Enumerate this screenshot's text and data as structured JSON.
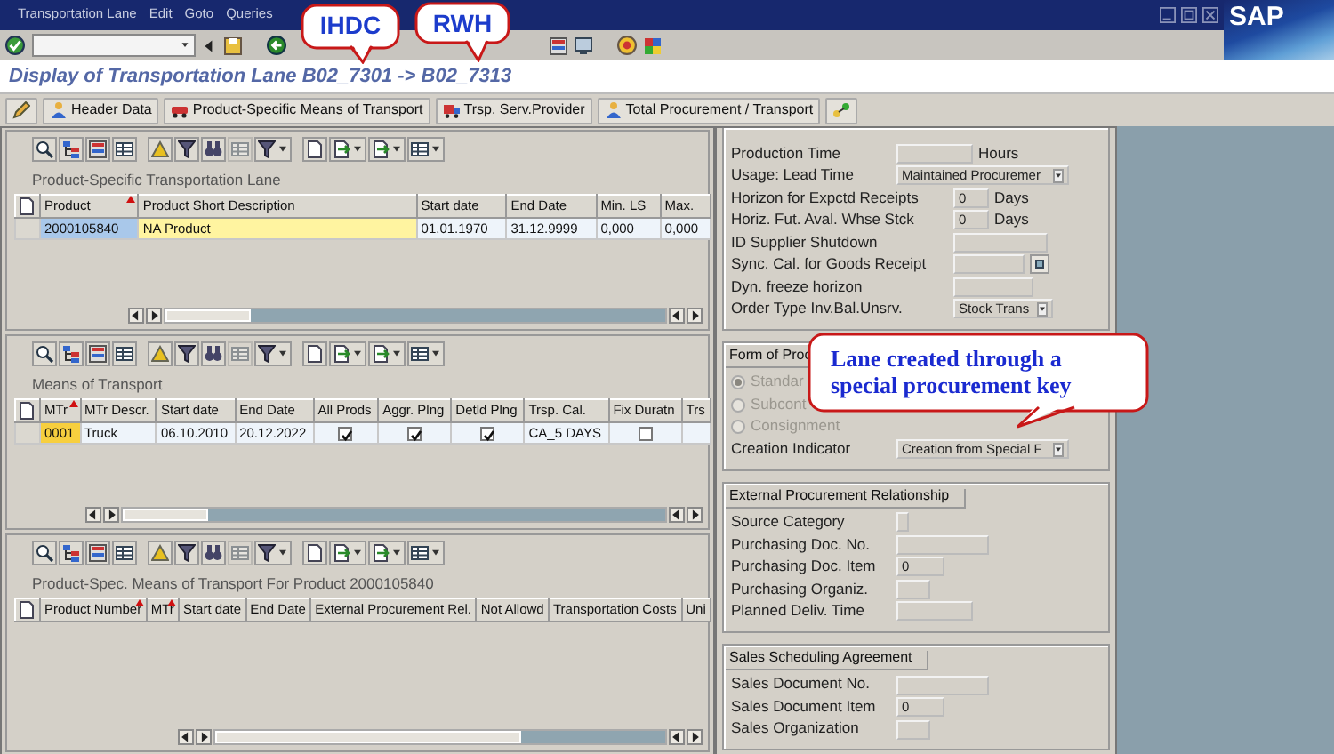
{
  "menu": [
    {
      "label": "Transportation Lane"
    },
    {
      "label": "Edit"
    },
    {
      "label": "Goto"
    },
    {
      "label": "Queries"
    }
  ],
  "logo": "SAP",
  "title": "Display of Transportation Lane B02_7301 -> B02_7313",
  "app_toolbar": [
    {
      "label": "Header Data"
    },
    {
      "label": "Product-Specific Means of Transport"
    },
    {
      "label": "Trsp. Serv.Provider"
    },
    {
      "label": "Total Procurement / Transport"
    }
  ],
  "grids": [
    {
      "title": "Product-Specific Transportation Lane",
      "columns": [
        {
          "label": "Product",
          "sorted": true
        },
        {
          "label": "Product Short Description",
          "sorted": false
        },
        {
          "label": "Start date",
          "sorted": false
        },
        {
          "label": "End Date",
          "sorted": false
        },
        {
          "label": "Min. LS",
          "sorted": false
        },
        {
          "label": "Max.",
          "sorted": false
        }
      ],
      "rows": [
        {
          "cells": [
            {
              "kind": "focus",
              "text": "2000105840"
            },
            {
              "kind": "highlight",
              "text": "NA Product"
            },
            {
              "kind": "text",
              "text": "01.01.1970"
            },
            {
              "kind": "text",
              "text": "31.12.9999"
            },
            {
              "kind": "text",
              "text": "0,000"
            },
            {
              "kind": "text",
              "text": "0,000"
            }
          ]
        }
      ]
    },
    {
      "title": "Means of Transport",
      "columns": [
        {
          "label": "MTr",
          "sorted": true
        },
        {
          "label": "MTr Descr.",
          "sorted": false
        },
        {
          "label": "Start date",
          "sorted": false
        },
        {
          "label": "End Date",
          "sorted": false
        },
        {
          "label": "All Prods",
          "sorted": false
        },
        {
          "label": "Aggr. Plng",
          "sorted": false
        },
        {
          "label": "Detld Plng",
          "sorted": false
        },
        {
          "label": "Trsp. Cal.",
          "sorted": false
        },
        {
          "label": "Fix Duratn",
          "sorted": false
        },
        {
          "label": "Trs",
          "sorted": false
        }
      ],
      "rows": [
        {
          "cells": [
            {
              "kind": "key",
              "text": "0001"
            },
            {
              "kind": "text",
              "text": "Truck"
            },
            {
              "kind": "text",
              "text": "06.10.2010"
            },
            {
              "kind": "text",
              "text": "20.12.2022"
            },
            {
              "kind": "checkbox",
              "checked": true
            },
            {
              "kind": "checkbox",
              "checked": true
            },
            {
              "kind": "checkbox",
              "checked": true
            },
            {
              "kind": "text",
              "text": "CA_5 DAYS"
            },
            {
              "kind": "checkbox",
              "checked": false
            },
            {
              "kind": "text"
            }
          ]
        }
      ]
    },
    {
      "title": "Product-Spec. Means of Transport For Product 2000105840",
      "columns": [
        {
          "label": "Product Number",
          "sorted": true
        },
        {
          "label": "MTr",
          "sorted": true
        },
        {
          "label": "Start date",
          "sorted": false
        },
        {
          "label": "End Date",
          "sorted": false
        },
        {
          "label": "External Procurement Rel.",
          "sorted": false
        },
        {
          "label": "Not Allowd",
          "sorted": false
        },
        {
          "label": "Transportation Costs",
          "sorted": false
        },
        {
          "label": "Uni",
          "sorted": false
        }
      ]
    }
  ],
  "form": {
    "rows": [
      {
        "label": "Production Time",
        "field": {
          "kind": "duration"
        },
        "unit": "Hours"
      },
      {
        "label": "Usage: Lead Time",
        "field": {
          "kind": "select",
          "value": "Maintained Procuremer"
        }
      },
      {
        "label": "Horizon for Expctd Receipts",
        "field": {
          "kind": "days",
          "value": "0"
        },
        "unit": "Days"
      },
      {
        "label": "Horiz. Fut. Aval. Whse Stck",
        "field": {
          "kind": "days",
          "value": "0"
        },
        "unit": "Days"
      },
      {
        "label": "ID Supplier Shutdown",
        "field": {
          "kind": "text"
        }
      },
      {
        "label": "Sync. Cal. for Goods Receipt",
        "field": {
          "kind": "lookup"
        }
      },
      {
        "label": "Dyn. freeze horizon",
        "field": {
          "kind": "horizon"
        }
      },
      {
        "label": "Order Type Inv.Bal.Unsrv.",
        "field": {
          "kind": "select-short",
          "value": "Stock Trans"
        }
      }
    ]
  },
  "groups": [
    {
      "title": "Form of Proc",
      "radios": [
        {
          "label": "Standar",
          "selected": true,
          "disabled": true
        },
        {
          "label": "Subcont",
          "selected": false,
          "disabled": true
        },
        {
          "label": "Consignment",
          "selected": false,
          "disabled": true
        }
      ],
      "rows": [
        {
          "label": "Creation Indicator",
          "field": {
            "kind": "select",
            "value": "Creation from Special F"
          }
        }
      ]
    },
    {
      "title": "External Procurement Relationship",
      "rows": [
        {
          "label": "Source Category",
          "field": {
            "kind": "flag"
          }
        },
        {
          "label": "Purchasing Doc. No.",
          "field": {
            "kind": "doc"
          }
        },
        {
          "label": "Purchasing Doc. Item",
          "field": {
            "kind": "item",
            "value": "0"
          }
        },
        {
          "label": "Purchasing Organiz.",
          "field": {
            "kind": "org"
          }
        },
        {
          "label": "Planned Deliv. Time",
          "field": {
            "kind": "duration"
          }
        }
      ]
    },
    {
      "title": "Sales Scheduling Agreement",
      "rows": [
        {
          "label": "Sales Document No.",
          "field": {
            "kind": "doc"
          }
        },
        {
          "label": "Sales Document Item",
          "field": {
            "kind": "item",
            "value": "0"
          }
        },
        {
          "label": "Sales Organization",
          "field": {
            "kind": "org"
          }
        }
      ]
    }
  ],
  "callouts": [
    {
      "text": "IHDC"
    },
    {
      "text": "RWH"
    },
    {
      "text": "Lane created through a special procurement key"
    }
  ]
}
